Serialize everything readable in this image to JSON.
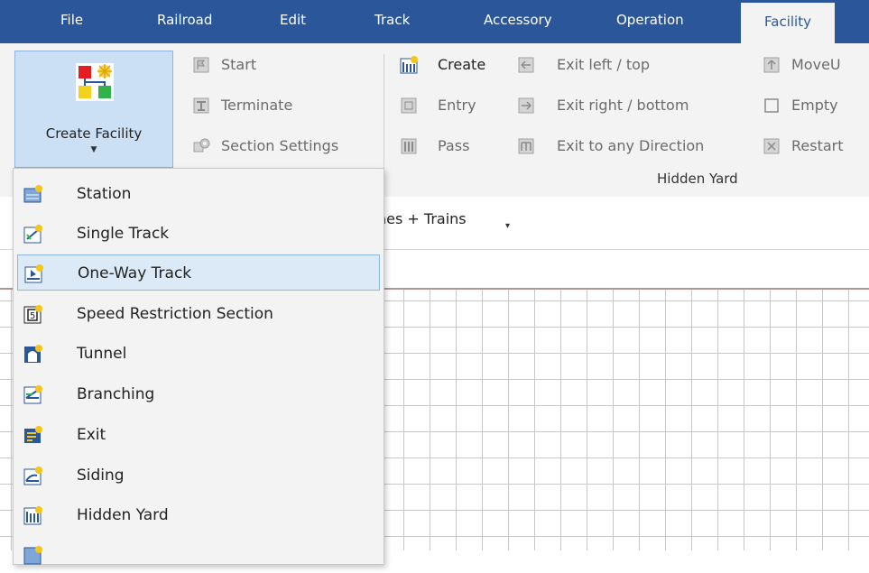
{
  "menu": {
    "tabs": [
      {
        "label": "File"
      },
      {
        "label": "Railroad"
      },
      {
        "label": "Edit"
      },
      {
        "label": "Track"
      },
      {
        "label": "Accessory"
      },
      {
        "label": "Operation"
      },
      {
        "label": "Facility",
        "active": true
      }
    ]
  },
  "ribbon": {
    "create_facility": {
      "label": "Create Facility",
      "icon": "create-facility-icon"
    },
    "section_items": [
      {
        "label": "Start",
        "icon": "start-icon",
        "enabled": false
      },
      {
        "label": "Terminate",
        "icon": "terminate-icon",
        "enabled": false
      },
      {
        "label": "Section Settings",
        "icon": "section-settings-icon",
        "enabled": false
      }
    ],
    "hidden_yard": {
      "group_label": "Hidden Yard",
      "col1": [
        {
          "label": "Create",
          "icon": "hidden-yard-create-icon",
          "enabled": true
        },
        {
          "label": "Entry",
          "icon": "entry-icon",
          "enabled": false
        },
        {
          "label": "Pass",
          "icon": "pass-icon",
          "enabled": false
        }
      ],
      "col2": [
        {
          "label": "Exit left / top",
          "icon": "exit-left-top-icon",
          "enabled": false
        },
        {
          "label": "Exit right / bottom",
          "icon": "exit-right-bottom-icon",
          "enabled": false
        },
        {
          "label": "Exit to any Direction",
          "icon": "exit-any-direction-icon",
          "enabled": false
        }
      ],
      "col3": [
        {
          "label": "MoveU",
          "icon": "move-up-icon",
          "enabled": false
        },
        {
          "label": "Empty",
          "icon": "empty-icon",
          "enabled": false
        },
        {
          "label": "Restart",
          "icon": "restart-icon",
          "enabled": false
        }
      ]
    }
  },
  "toolbar": {
    "view_label": "nes + Trains"
  },
  "dropdown": {
    "items": [
      {
        "label": "Station",
        "icon": "station-icon"
      },
      {
        "label": "Single Track",
        "icon": "single-track-icon"
      },
      {
        "label": "One-Way Track",
        "icon": "one-way-track-icon",
        "hover": true
      },
      {
        "label": "Speed Restriction Section",
        "icon": "speed-restriction-icon"
      },
      {
        "label": "Tunnel",
        "icon": "tunnel-icon"
      },
      {
        "label": "Branching",
        "icon": "branching-icon"
      },
      {
        "label": "Exit",
        "icon": "exit-icon"
      },
      {
        "label": "Siding",
        "icon": "siding-icon"
      },
      {
        "label": "Hidden Yard",
        "icon": "hidden-yard-icon"
      }
    ]
  },
  "colors": {
    "accent": "#2b579a",
    "ribbon_bg": "#f3f3f3",
    "hover": "#dceaf8"
  }
}
